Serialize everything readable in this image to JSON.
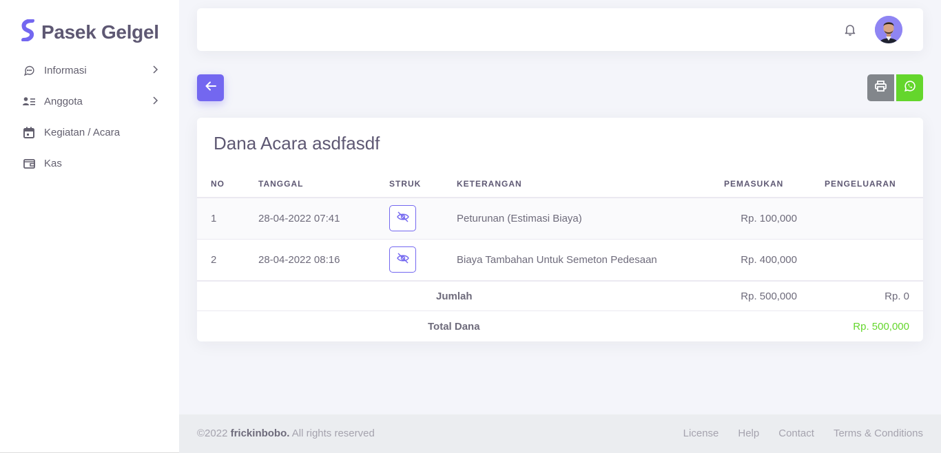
{
  "brand": {
    "name": "Pasek Gelgel",
    "color": "#7367f0"
  },
  "sidebar": {
    "items": [
      {
        "label": "Informasi",
        "icon": "message-circle-icon",
        "has_chevron": true
      },
      {
        "label": "Anggota",
        "icon": "user-list-icon",
        "has_chevron": true
      },
      {
        "label": "Kegiatan / Acara",
        "icon": "calendar-icon",
        "has_chevron": false
      },
      {
        "label": "Kas",
        "icon": "wallet-icon",
        "has_chevron": false
      }
    ]
  },
  "navbar": {
    "notification_icon": "bell-icon",
    "avatar_icon": "user-avatar"
  },
  "actions": {
    "back_icon": "arrow-left-icon",
    "print_icon": "printer-icon",
    "whatsapp_icon": "whatsapp-icon"
  },
  "card": {
    "title": "Dana Acara asdfasdf",
    "columns": [
      "NO",
      "TANGGAL",
      "STRUK",
      "KETERANGAN",
      "PEMASUKAN",
      "PENGELUARAN"
    ],
    "rows": [
      {
        "no": "1",
        "tanggal": "28-04-2022 07:41",
        "struk_icon": "eye-off-icon",
        "keterangan": "Peturunan (Estimasi Biaya)",
        "pemasukan": "Rp. 100,000",
        "pengeluaran": ""
      },
      {
        "no": "2",
        "tanggal": "28-04-2022 08:16",
        "struk_icon": "eye-off-icon",
        "keterangan": "Biaya Tambahan Untuk Semeton Pedesaan",
        "pemasukan": "Rp. 400,000",
        "pengeluaran": ""
      }
    ],
    "summary": {
      "label": "Jumlah",
      "pemasukan": "Rp. 500,000",
      "pengeluaran": "Rp. 0"
    },
    "total": {
      "label": "Total Dana",
      "value": "Rp. 500,000",
      "color": "#64d62c"
    }
  },
  "footer": {
    "copyright_prefix": "©2022",
    "author": "frickinbobo.",
    "rights": "All rights reserved",
    "links": [
      "License",
      "Help",
      "Contact",
      "Terms & Conditions"
    ]
  }
}
